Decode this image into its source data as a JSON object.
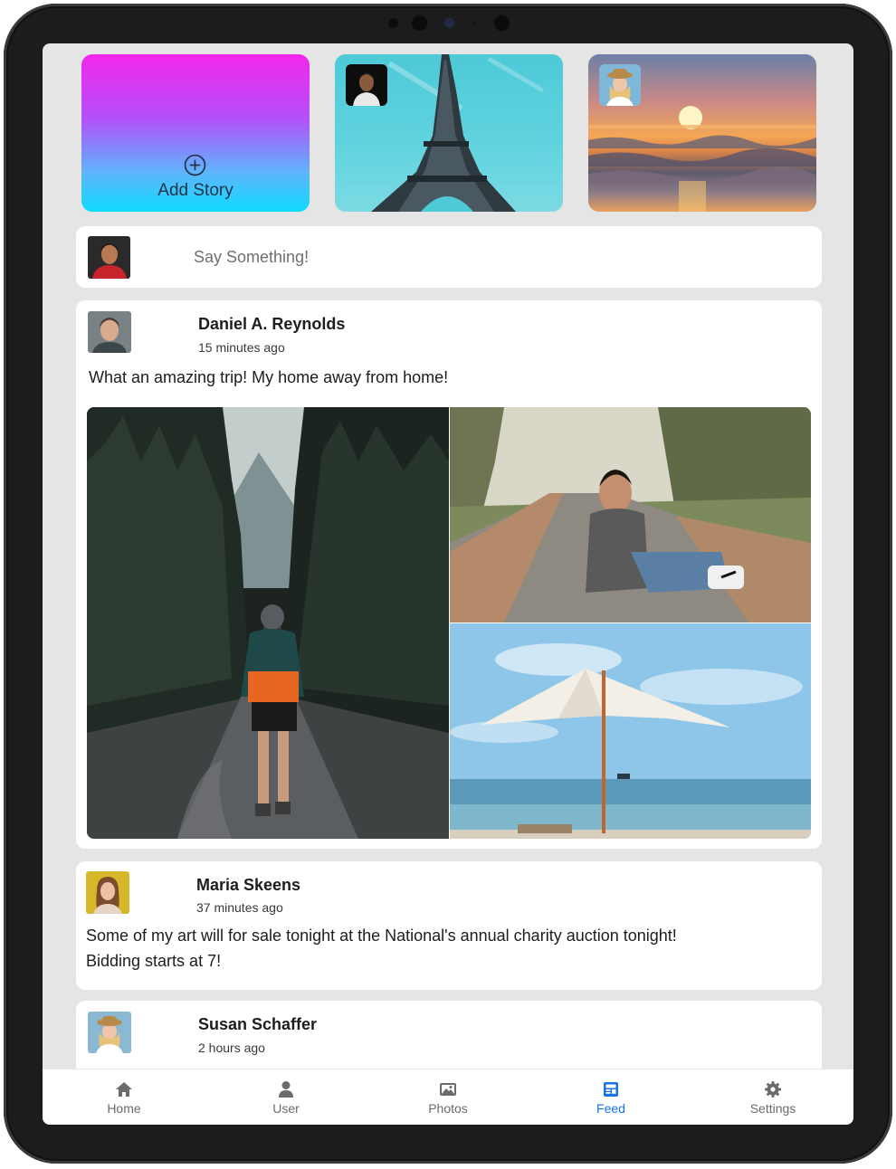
{
  "stories": {
    "add_label": "Add Story",
    "add_icon": "plus-circle-icon"
  },
  "compose": {
    "placeholder": "Say Something!"
  },
  "posts": [
    {
      "author": "Daniel A. Reynolds",
      "time": "15 minutes ago",
      "text": "What an amazing trip! My home away from home!"
    },
    {
      "author": "Maria Skeens",
      "time": "37 minutes ago",
      "text": "Some of my art will for sale tonight at the National's annual charity auction tonight! Bidding starts at 7!"
    },
    {
      "author": "Susan Schaffer",
      "time": "2 hours ago"
    }
  ],
  "tabs": [
    {
      "label": "Home",
      "icon": "home-icon"
    },
    {
      "label": "User",
      "icon": "user-icon"
    },
    {
      "label": "Photos",
      "icon": "photos-icon"
    },
    {
      "label": "Feed",
      "icon": "feed-icon",
      "active": true
    },
    {
      "label": "Settings",
      "icon": "gear-icon"
    }
  ],
  "colors": {
    "accent": "#1a73e8",
    "background": "#e5e5e5",
    "story_gradient_top": "#f227ec",
    "story_gradient_bottom": "#0fdcff"
  }
}
